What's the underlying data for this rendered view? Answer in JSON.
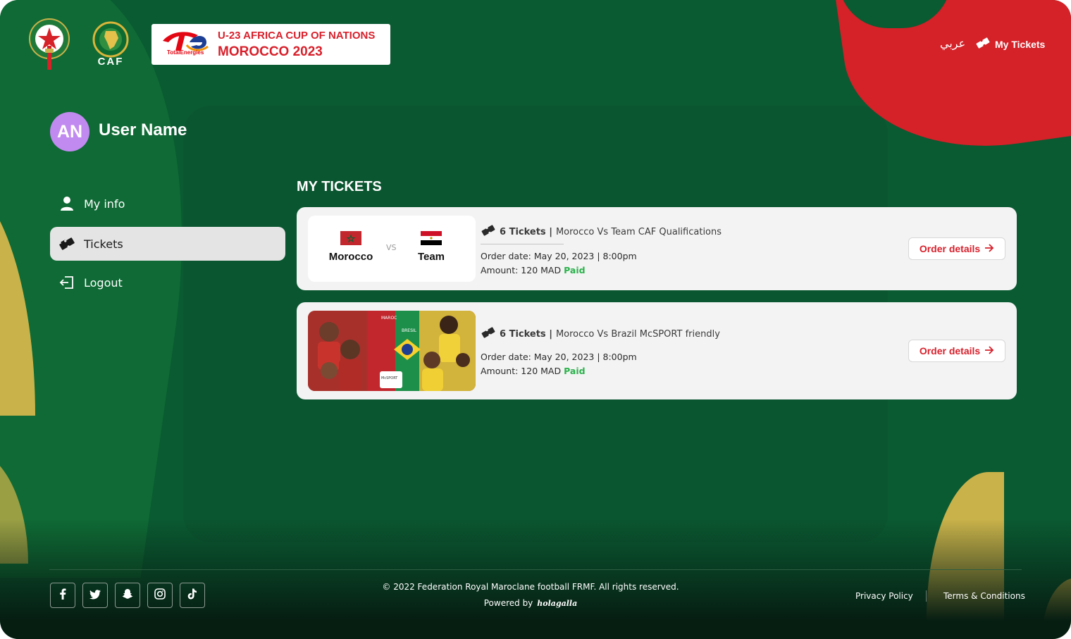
{
  "header": {
    "caf_label": "CAF",
    "te_brand": "TotalEnergies",
    "event_title": "U-23 AFRICA CUP OF NATIONS",
    "event_subtitle": "MOROCCO 2023",
    "lang_link": "عربي",
    "nav_tickets": "My Tickets"
  },
  "user": {
    "initials": "AN",
    "name": "User Name"
  },
  "sidebar": {
    "items": [
      {
        "label": "My info",
        "icon": "user-icon",
        "active": false
      },
      {
        "label": "Tickets",
        "icon": "ticket-icon",
        "active": true
      },
      {
        "label": "Logout",
        "icon": "logout-icon",
        "active": false
      }
    ]
  },
  "main": {
    "title": "MY TICKETS",
    "tickets": [
      {
        "home_team": "Morocco",
        "away_team": "Team",
        "vs": "VS",
        "count": "6 Tickets |",
        "match": "Morocco Vs Team CAF Qualifications",
        "order_date": "Order date: May 20, 2023 | 8:00pm",
        "amount": "Amount: 120 MAD",
        "status": "Paid",
        "button": "Order details"
      },
      {
        "thumb_left": "MAROC",
        "thumb_right": "BRESIL",
        "thumb_badge": "McSPORT",
        "count": "6 Tickets |",
        "match": "Morocco Vs Brazil McSPORT friendly",
        "order_date": "Order date: May 20, 2023 | 8:00pm",
        "amount": "Amount: 120 MAD",
        "status": "Paid",
        "button": "Order details"
      }
    ]
  },
  "footer": {
    "copyright": "© 2022 Federation Royal Maroclane football FRMF. All rights reserved.",
    "powered_by": "Powered by",
    "powered_logo": "holagalla",
    "privacy": "Privacy Policy",
    "terms": "Terms & Conditions",
    "social": [
      "facebook-icon",
      "twitter-icon",
      "snapchat-icon",
      "instagram-icon",
      "tiktok-icon"
    ]
  },
  "colors": {
    "background": "#0a5a32",
    "accent_red": "#d8202b",
    "gold": "#c9b24a",
    "avatar": "#c18af0",
    "paid": "#2bb24c"
  }
}
